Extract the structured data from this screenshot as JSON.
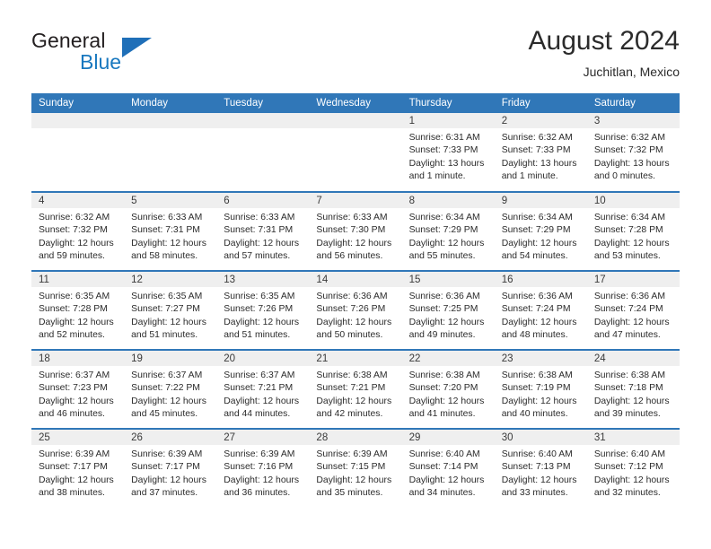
{
  "brand": {
    "name_part1": "General",
    "name_part2": "Blue",
    "flag_icon": "blue-triangle-flag-icon",
    "accent_color": "#1f6fb8"
  },
  "header": {
    "title": "August 2024",
    "subtitle": "Juchitlan, Mexico"
  },
  "calendar": {
    "header_bg_color": "#3077b8",
    "daynum_bg_color": "#efefef",
    "weekdays": [
      "Sunday",
      "Monday",
      "Tuesday",
      "Wednesday",
      "Thursday",
      "Friday",
      "Saturday"
    ],
    "weeks": [
      [
        {
          "day": "",
          "sunrise": "",
          "sunset": "",
          "daylight": ""
        },
        {
          "day": "",
          "sunrise": "",
          "sunset": "",
          "daylight": ""
        },
        {
          "day": "",
          "sunrise": "",
          "sunset": "",
          "daylight": ""
        },
        {
          "day": "",
          "sunrise": "",
          "sunset": "",
          "daylight": ""
        },
        {
          "day": "1",
          "sunrise": "Sunrise: 6:31 AM",
          "sunset": "Sunset: 7:33 PM",
          "daylight": "Daylight: 13 hours and 1 minute."
        },
        {
          "day": "2",
          "sunrise": "Sunrise: 6:32 AM",
          "sunset": "Sunset: 7:33 PM",
          "daylight": "Daylight: 13 hours and 1 minute."
        },
        {
          "day": "3",
          "sunrise": "Sunrise: 6:32 AM",
          "sunset": "Sunset: 7:32 PM",
          "daylight": "Daylight: 13 hours and 0 minutes."
        }
      ],
      [
        {
          "day": "4",
          "sunrise": "Sunrise: 6:32 AM",
          "sunset": "Sunset: 7:32 PM",
          "daylight": "Daylight: 12 hours and 59 minutes."
        },
        {
          "day": "5",
          "sunrise": "Sunrise: 6:33 AM",
          "sunset": "Sunset: 7:31 PM",
          "daylight": "Daylight: 12 hours and 58 minutes."
        },
        {
          "day": "6",
          "sunrise": "Sunrise: 6:33 AM",
          "sunset": "Sunset: 7:31 PM",
          "daylight": "Daylight: 12 hours and 57 minutes."
        },
        {
          "day": "7",
          "sunrise": "Sunrise: 6:33 AM",
          "sunset": "Sunset: 7:30 PM",
          "daylight": "Daylight: 12 hours and 56 minutes."
        },
        {
          "day": "8",
          "sunrise": "Sunrise: 6:34 AM",
          "sunset": "Sunset: 7:29 PM",
          "daylight": "Daylight: 12 hours and 55 minutes."
        },
        {
          "day": "9",
          "sunrise": "Sunrise: 6:34 AM",
          "sunset": "Sunset: 7:29 PM",
          "daylight": "Daylight: 12 hours and 54 minutes."
        },
        {
          "day": "10",
          "sunrise": "Sunrise: 6:34 AM",
          "sunset": "Sunset: 7:28 PM",
          "daylight": "Daylight: 12 hours and 53 minutes."
        }
      ],
      [
        {
          "day": "11",
          "sunrise": "Sunrise: 6:35 AM",
          "sunset": "Sunset: 7:28 PM",
          "daylight": "Daylight: 12 hours and 52 minutes."
        },
        {
          "day": "12",
          "sunrise": "Sunrise: 6:35 AM",
          "sunset": "Sunset: 7:27 PM",
          "daylight": "Daylight: 12 hours and 51 minutes."
        },
        {
          "day": "13",
          "sunrise": "Sunrise: 6:35 AM",
          "sunset": "Sunset: 7:26 PM",
          "daylight": "Daylight: 12 hours and 51 minutes."
        },
        {
          "day": "14",
          "sunrise": "Sunrise: 6:36 AM",
          "sunset": "Sunset: 7:26 PM",
          "daylight": "Daylight: 12 hours and 50 minutes."
        },
        {
          "day": "15",
          "sunrise": "Sunrise: 6:36 AM",
          "sunset": "Sunset: 7:25 PM",
          "daylight": "Daylight: 12 hours and 49 minutes."
        },
        {
          "day": "16",
          "sunrise": "Sunrise: 6:36 AM",
          "sunset": "Sunset: 7:24 PM",
          "daylight": "Daylight: 12 hours and 48 minutes."
        },
        {
          "day": "17",
          "sunrise": "Sunrise: 6:36 AM",
          "sunset": "Sunset: 7:24 PM",
          "daylight": "Daylight: 12 hours and 47 minutes."
        }
      ],
      [
        {
          "day": "18",
          "sunrise": "Sunrise: 6:37 AM",
          "sunset": "Sunset: 7:23 PM",
          "daylight": "Daylight: 12 hours and 46 minutes."
        },
        {
          "day": "19",
          "sunrise": "Sunrise: 6:37 AM",
          "sunset": "Sunset: 7:22 PM",
          "daylight": "Daylight: 12 hours and 45 minutes."
        },
        {
          "day": "20",
          "sunrise": "Sunrise: 6:37 AM",
          "sunset": "Sunset: 7:21 PM",
          "daylight": "Daylight: 12 hours and 44 minutes."
        },
        {
          "day": "21",
          "sunrise": "Sunrise: 6:38 AM",
          "sunset": "Sunset: 7:21 PM",
          "daylight": "Daylight: 12 hours and 42 minutes."
        },
        {
          "day": "22",
          "sunrise": "Sunrise: 6:38 AM",
          "sunset": "Sunset: 7:20 PM",
          "daylight": "Daylight: 12 hours and 41 minutes."
        },
        {
          "day": "23",
          "sunrise": "Sunrise: 6:38 AM",
          "sunset": "Sunset: 7:19 PM",
          "daylight": "Daylight: 12 hours and 40 minutes."
        },
        {
          "day": "24",
          "sunrise": "Sunrise: 6:38 AM",
          "sunset": "Sunset: 7:18 PM",
          "daylight": "Daylight: 12 hours and 39 minutes."
        }
      ],
      [
        {
          "day": "25",
          "sunrise": "Sunrise: 6:39 AM",
          "sunset": "Sunset: 7:17 PM",
          "daylight": "Daylight: 12 hours and 38 minutes."
        },
        {
          "day": "26",
          "sunrise": "Sunrise: 6:39 AM",
          "sunset": "Sunset: 7:17 PM",
          "daylight": "Daylight: 12 hours and 37 minutes."
        },
        {
          "day": "27",
          "sunrise": "Sunrise: 6:39 AM",
          "sunset": "Sunset: 7:16 PM",
          "daylight": "Daylight: 12 hours and 36 minutes."
        },
        {
          "day": "28",
          "sunrise": "Sunrise: 6:39 AM",
          "sunset": "Sunset: 7:15 PM",
          "daylight": "Daylight: 12 hours and 35 minutes."
        },
        {
          "day": "29",
          "sunrise": "Sunrise: 6:40 AM",
          "sunset": "Sunset: 7:14 PM",
          "daylight": "Daylight: 12 hours and 34 minutes."
        },
        {
          "day": "30",
          "sunrise": "Sunrise: 6:40 AM",
          "sunset": "Sunset: 7:13 PM",
          "daylight": "Daylight: 12 hours and 33 minutes."
        },
        {
          "day": "31",
          "sunrise": "Sunrise: 6:40 AM",
          "sunset": "Sunset: 7:12 PM",
          "daylight": "Daylight: 12 hours and 32 minutes."
        }
      ]
    ]
  }
}
